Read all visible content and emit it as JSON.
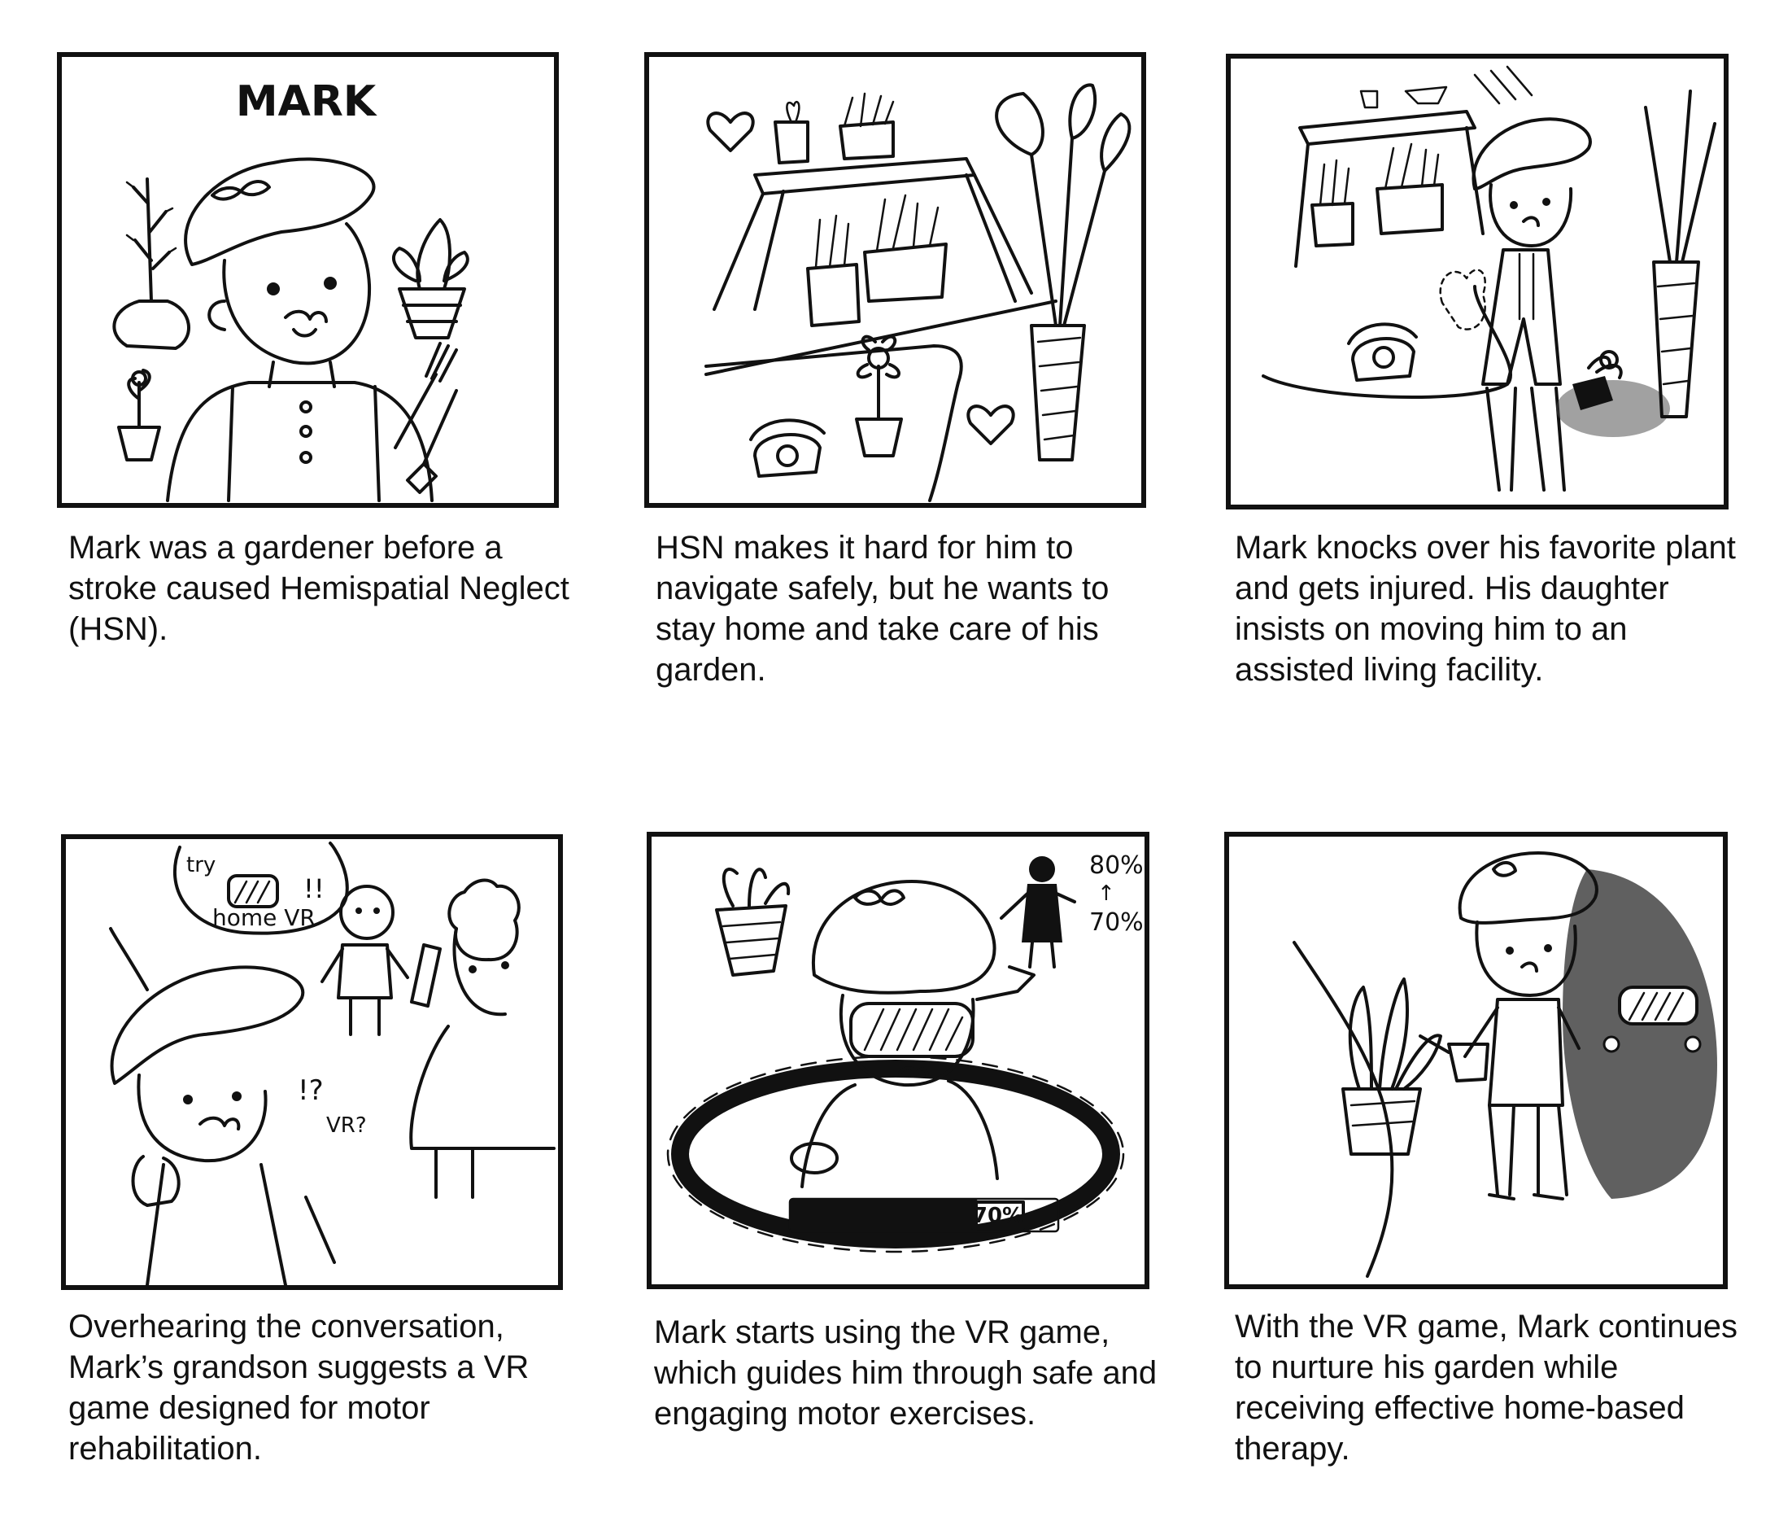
{
  "panels": [
    {
      "illustration": "Mark portrait with garden plants and tools",
      "drawn_label": "MARK",
      "caption": "Mark was a gardener before a stroke caused Hemispatial Neglect (HSN)."
    },
    {
      "illustration": "Home garden room with shelf plants, flower, phone and hearts",
      "caption": "HSN makes it hard for him to navigate safely, but he wants to stay home and take care of his garden."
    },
    {
      "illustration": "Mark knocks over a plant in the garden room",
      "caption": "Mark knocks over his favorite plant and gets injured. His daughter insists on moving him to an assisted living facility."
    },
    {
      "illustration": "Grandson suggests home VR while daughter talks on phone",
      "speech_top": "try",
      "speech_exclaim": "!!",
      "speech_bottom": "home VR",
      "mark_reaction": "!?",
      "mark_question": "VR?",
      "caption": "Overhearing the conversation, Mark’s grandson suggests a VR game designed for motor rehabilitation."
    },
    {
      "illustration": "Mark playing VR game with progress bar",
      "progress_top": "80%",
      "progress_arrow": "↑",
      "progress_bottom": "70%",
      "bar_label": "70%",
      "progress_fraction": 0.7,
      "caption": "Mark starts using the VR game, which guides him through safe and engaging motor exercises."
    },
    {
      "illustration": "Mark watering plants at home with VR headset nearby",
      "caption": "With the VR game, Mark continues to nurture his garden while receiving effective home-based therapy."
    }
  ],
  "colors": {
    "ink": "#111111",
    "paper": "#ffffff",
    "shade": "#444444"
  }
}
